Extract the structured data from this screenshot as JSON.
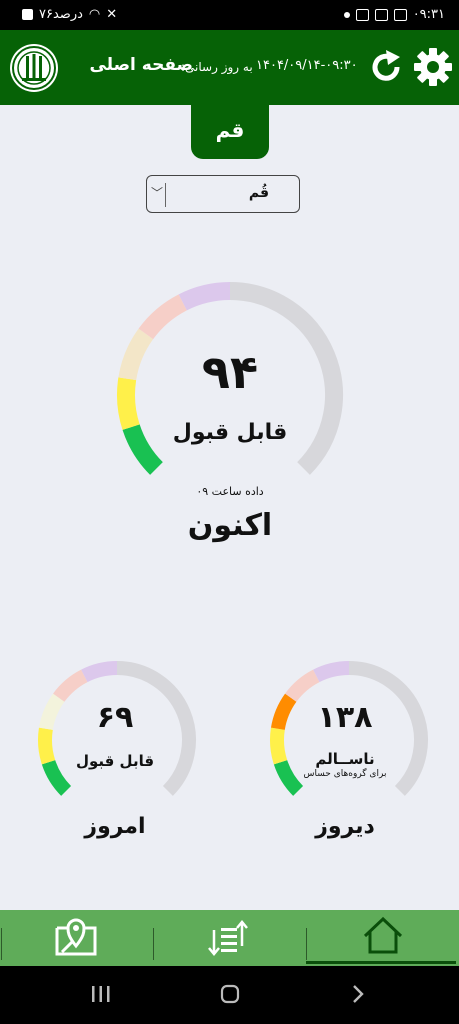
{
  "status_bar": {
    "time": "۰۹:۳۱",
    "battery": "۷۶درصد"
  },
  "header": {
    "title": "صفحه اصلی",
    "update_label": "به روز رسانی:",
    "update_time": "۱۴۰۴/۰۹/۱۴-۰۹:۳۰"
  },
  "city_tab": "قم",
  "city_select": {
    "value": "قُم"
  },
  "gauges": {
    "now": {
      "value": "۹۴",
      "status": "قابل قبول",
      "data_hour": "داده ساعت ۰۹",
      "period": "اکنون",
      "aqi": 94,
      "ring_color": "#d7d7db",
      "segments": [
        "#19c152",
        "#fff04a",
        "#f3e6c8",
        "#f6cfc8",
        "#dcc8ec"
      ]
    },
    "yesterday": {
      "value": "۱۳۸",
      "status": "ناســالم",
      "sub_status": "برای گروه‌های حساس",
      "period": "دیروز",
      "aqi": 138,
      "segments": [
        "#19c152",
        "#fff04a",
        "#ff8c00",
        "#f6cfc8",
        "#dcc8ec"
      ]
    },
    "today": {
      "value": "۶۹",
      "status": "قابل قبول",
      "period": "امروز",
      "aqi": 69,
      "segments": [
        "#19c152",
        "#fff04a",
        "#f3f3dc",
        "#f6cfc8",
        "#dcc8ec"
      ]
    }
  },
  "icons": {
    "logo": "agency-logo-icon",
    "refresh": "refresh-icon",
    "settings": "gear-icon",
    "map": "map-pin-icon",
    "sort": "sort-list-icon",
    "home": "home-icon"
  },
  "colors": {
    "header_green": "#066206",
    "nav_green": "#5fac59",
    "background": "#eceef4"
  }
}
